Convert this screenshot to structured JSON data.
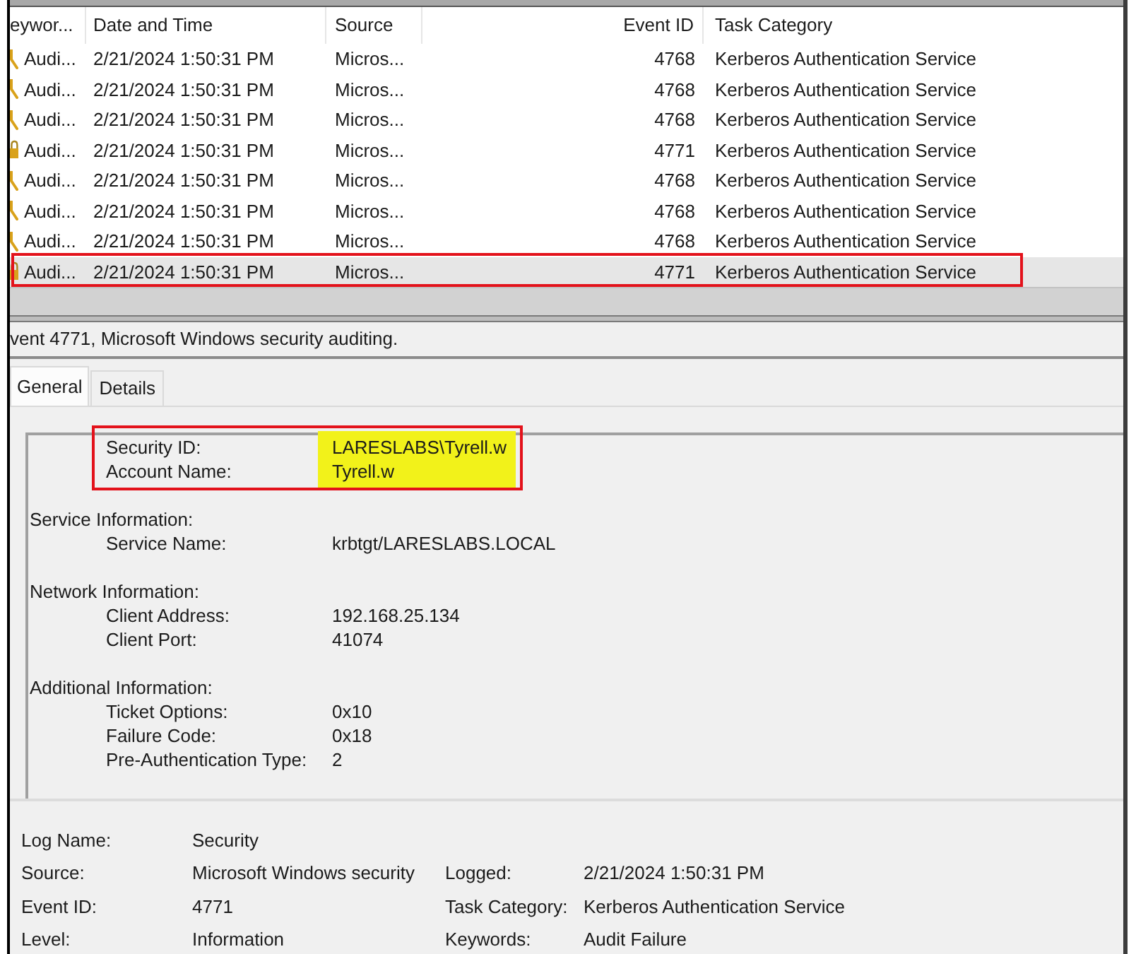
{
  "events_table": {
    "columns": [
      "eywor...",
      "Date and Time",
      "Source",
      "Event ID",
      "Task Category"
    ],
    "rows": [
      {
        "kind": "key",
        "keywords": "Audi...",
        "date_time": "2/21/2024 1:50:31 PM",
        "source": "Micros...",
        "event_id": "4768",
        "task_category": "Kerberos Authentication Service",
        "selected": false,
        "outlined": false
      },
      {
        "kind": "key",
        "keywords": "Audi...",
        "date_time": "2/21/2024 1:50:31 PM",
        "source": "Micros...",
        "event_id": "4768",
        "task_category": "Kerberos Authentication Service",
        "selected": false,
        "outlined": false
      },
      {
        "kind": "key",
        "keywords": "Audi...",
        "date_time": "2/21/2024 1:50:31 PM",
        "source": "Micros...",
        "event_id": "4768",
        "task_category": "Kerberos Authentication Service",
        "selected": false,
        "outlined": false
      },
      {
        "kind": "lock",
        "keywords": "Audi...",
        "date_time": "2/21/2024 1:50:31 PM",
        "source": "Micros...",
        "event_id": "4771",
        "task_category": "Kerberos Authentication Service",
        "selected": false,
        "outlined": false
      },
      {
        "kind": "key",
        "keywords": "Audi...",
        "date_time": "2/21/2024 1:50:31 PM",
        "source": "Micros...",
        "event_id": "4768",
        "task_category": "Kerberos Authentication Service",
        "selected": false,
        "outlined": false
      },
      {
        "kind": "key",
        "keywords": "Audi...",
        "date_time": "2/21/2024 1:50:31 PM",
        "source": "Micros...",
        "event_id": "4768",
        "task_category": "Kerberos Authentication Service",
        "selected": false,
        "outlined": false
      },
      {
        "kind": "key",
        "keywords": "Audi...",
        "date_time": "2/21/2024 1:50:31 PM",
        "source": "Micros...",
        "event_id": "4768",
        "task_category": "Kerberos Authentication Service",
        "selected": false,
        "outlined": false
      },
      {
        "kind": "lock",
        "keywords": "Audi...",
        "date_time": "2/21/2024 1:50:31 PM",
        "source": "Micros...",
        "event_id": "4771",
        "task_category": "Kerberos Authentication Service",
        "selected": true,
        "outlined": true
      }
    ]
  },
  "event_header": {
    "title": "vent 4771, Microsoft Windows security auditing."
  },
  "tabs": [
    {
      "label": "General",
      "selected": true
    },
    {
      "label": "Details",
      "selected": false
    }
  ],
  "description": {
    "sections": [
      {
        "outlined": true,
        "fields": [
          {
            "label": "Security ID:",
            "value": "LARESLABS\\Tyrell.w",
            "highlighted": true
          },
          {
            "label": "Account Name:",
            "value": "Tyrell.w",
            "highlighted": true
          }
        ]
      },
      {
        "heading": "Service Information:",
        "outlined": false,
        "fields": [
          {
            "label": "Service Name:",
            "value": "krbtgt/LARESLABS.LOCAL",
            "highlighted": false
          }
        ]
      },
      {
        "heading": "Network Information:",
        "outlined": false,
        "fields": [
          {
            "label": "Client Address:",
            "value": "192.168.25.134",
            "highlighted": false
          },
          {
            "label": "Client Port:",
            "value": "41074",
            "highlighted": false
          }
        ]
      },
      {
        "heading": "Additional Information:",
        "outlined": false,
        "fields": [
          {
            "label": "Ticket Options:",
            "value": "0x10",
            "highlighted": false
          },
          {
            "label": "Failure Code:",
            "value": "0x18",
            "highlighted": false
          },
          {
            "label": "Pre-Authentication Type:",
            "value": "2",
            "highlighted": false
          }
        ]
      }
    ]
  },
  "properties": [
    {
      "items": [
        {
          "label": "Log Name:",
          "value": "Security"
        }
      ]
    },
    {
      "items": [
        {
          "label": "Source:",
          "value": "Microsoft Windows security"
        },
        {
          "label": "Logged:",
          "value": "2/21/2024 1:50:31 PM"
        }
      ]
    },
    {
      "items": [
        {
          "label": "Event ID:",
          "value": "4771"
        },
        {
          "label": "Task Category:",
          "value": "Kerberos Authentication Service"
        }
      ]
    },
    {
      "items": [
        {
          "label": "Level:",
          "value": "Information"
        },
        {
          "label": "Keywords:",
          "value": "Audit Failure"
        }
      ]
    }
  ]
}
